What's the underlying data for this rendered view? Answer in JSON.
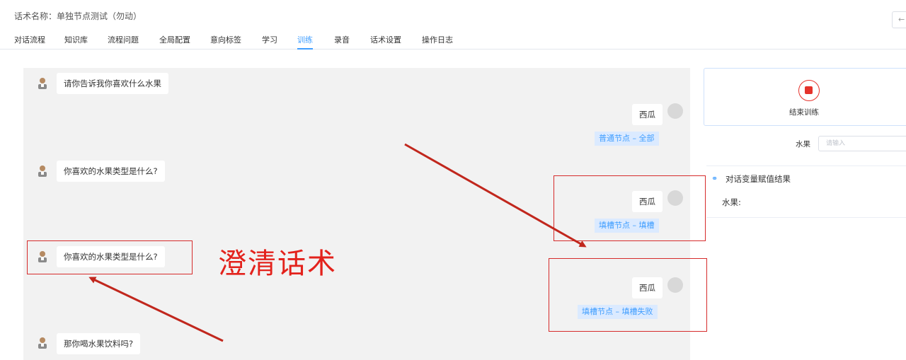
{
  "header": {
    "title": "话术名称：单独节点测试（勿动）",
    "back_icon": "←"
  },
  "tabs": [
    {
      "label": "对话流程"
    },
    {
      "label": "知识库"
    },
    {
      "label": "流程问题"
    },
    {
      "label": "全局配置"
    },
    {
      "label": "意向标签"
    },
    {
      "label": "学习"
    },
    {
      "label": "训练",
      "active": true
    },
    {
      "label": "录音"
    },
    {
      "label": "话术设置"
    },
    {
      "label": "操作日志"
    }
  ],
  "chat": {
    "messages": [
      {
        "role": "bot",
        "text": "请你告诉我你喜欢什么水果"
      },
      {
        "role": "user",
        "text": "西瓜",
        "tag": "普通节点 – 全部"
      },
      {
        "role": "bot",
        "text": "你喜欢的水果类型是什么?"
      },
      {
        "role": "user",
        "text": "西瓜",
        "tag": "填槽节点 – 填槽"
      },
      {
        "role": "bot",
        "text": "你喜欢的水果类型是什么?"
      },
      {
        "role": "user",
        "text": "西瓜",
        "tag": "填槽节点 – 填槽失败"
      },
      {
        "role": "bot",
        "text": "那你喝水果饮料吗?"
      }
    ]
  },
  "annotation": {
    "text": "澄清话术",
    "color": "#e3221c"
  },
  "sidebar": {
    "stop_label": "结束训练",
    "variable_label": "水果",
    "variable_placeholder": "请输入",
    "result_title": "对话变量赋值结果",
    "result_row": "水果:"
  },
  "colors": {
    "accent": "#409eff",
    "stop": "#e5322b",
    "annotation": "#d62b2b",
    "chat_bg": "#f2f2f2"
  }
}
